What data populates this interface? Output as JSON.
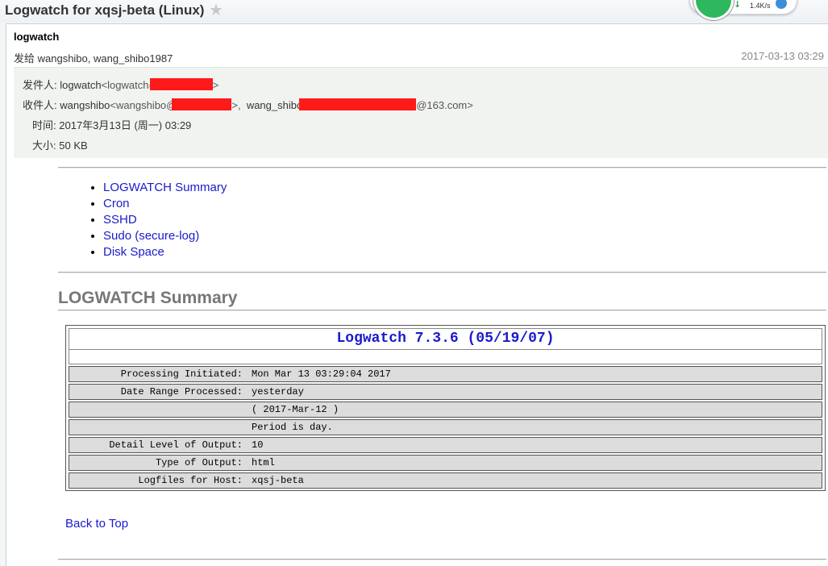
{
  "window": {
    "title": "Logwatch for xqsj-beta (Linux)",
    "star_icon": "star-icon",
    "net_widget_speed": "1.4K/s"
  },
  "email": {
    "subject": "logwatch",
    "to_line": "发给 wangshibo, wang_shibo1987",
    "date": "2017-03-13 03:29",
    "headers": {
      "from_label": "发件人:",
      "from_name": "logwatch",
      "from_addr_prefix": "<logwatch@",
      "from_addr_suffix": ">",
      "to_label": "收件人:",
      "to_name1": "wangshibo",
      "to_addr1_prefix": "<wangshibo@",
      "to_addr1_suffix": ">,",
      "to_name2": "wang_shibo",
      "to_addr2_suffix": "@163.com>",
      "time_label": "时间:",
      "time_value": "2017年3月13日 (周一) 03:29",
      "size_label": "大小:",
      "size_value": "50 KB"
    }
  },
  "toc": [
    {
      "label": "LOGWATCH Summary"
    },
    {
      "label": "Cron"
    },
    {
      "label": "SSHD"
    },
    {
      "label": "Sudo (secure-log)"
    },
    {
      "label": "Disk Space"
    }
  ],
  "section": {
    "title": "LOGWATCH Summary"
  },
  "summary": {
    "heading": "Logwatch 7.3.6 (05/19/07)",
    "rows": [
      {
        "key": "Processing Initiated:",
        "value": "Mon Mar 13 03:29:04 2017"
      },
      {
        "key": "Date Range Processed:",
        "value": "yesterday"
      },
      {
        "key": "",
        "value": "( 2017-Mar-12 )"
      },
      {
        "key": "",
        "value": "Period is day."
      },
      {
        "key": "Detail Level of Output:",
        "value": "10"
      },
      {
        "key": "Type of Output:",
        "value": "html"
      },
      {
        "key": "Logfiles for Host:",
        "value": "xqsj-beta"
      }
    ]
  },
  "back_to_top": "Back to Top",
  "colors": {
    "link": "#1a1acc",
    "redaction": "#ff1a1a",
    "header_bg": "#f1f3f1",
    "row_bg": "#dcdcdc"
  }
}
